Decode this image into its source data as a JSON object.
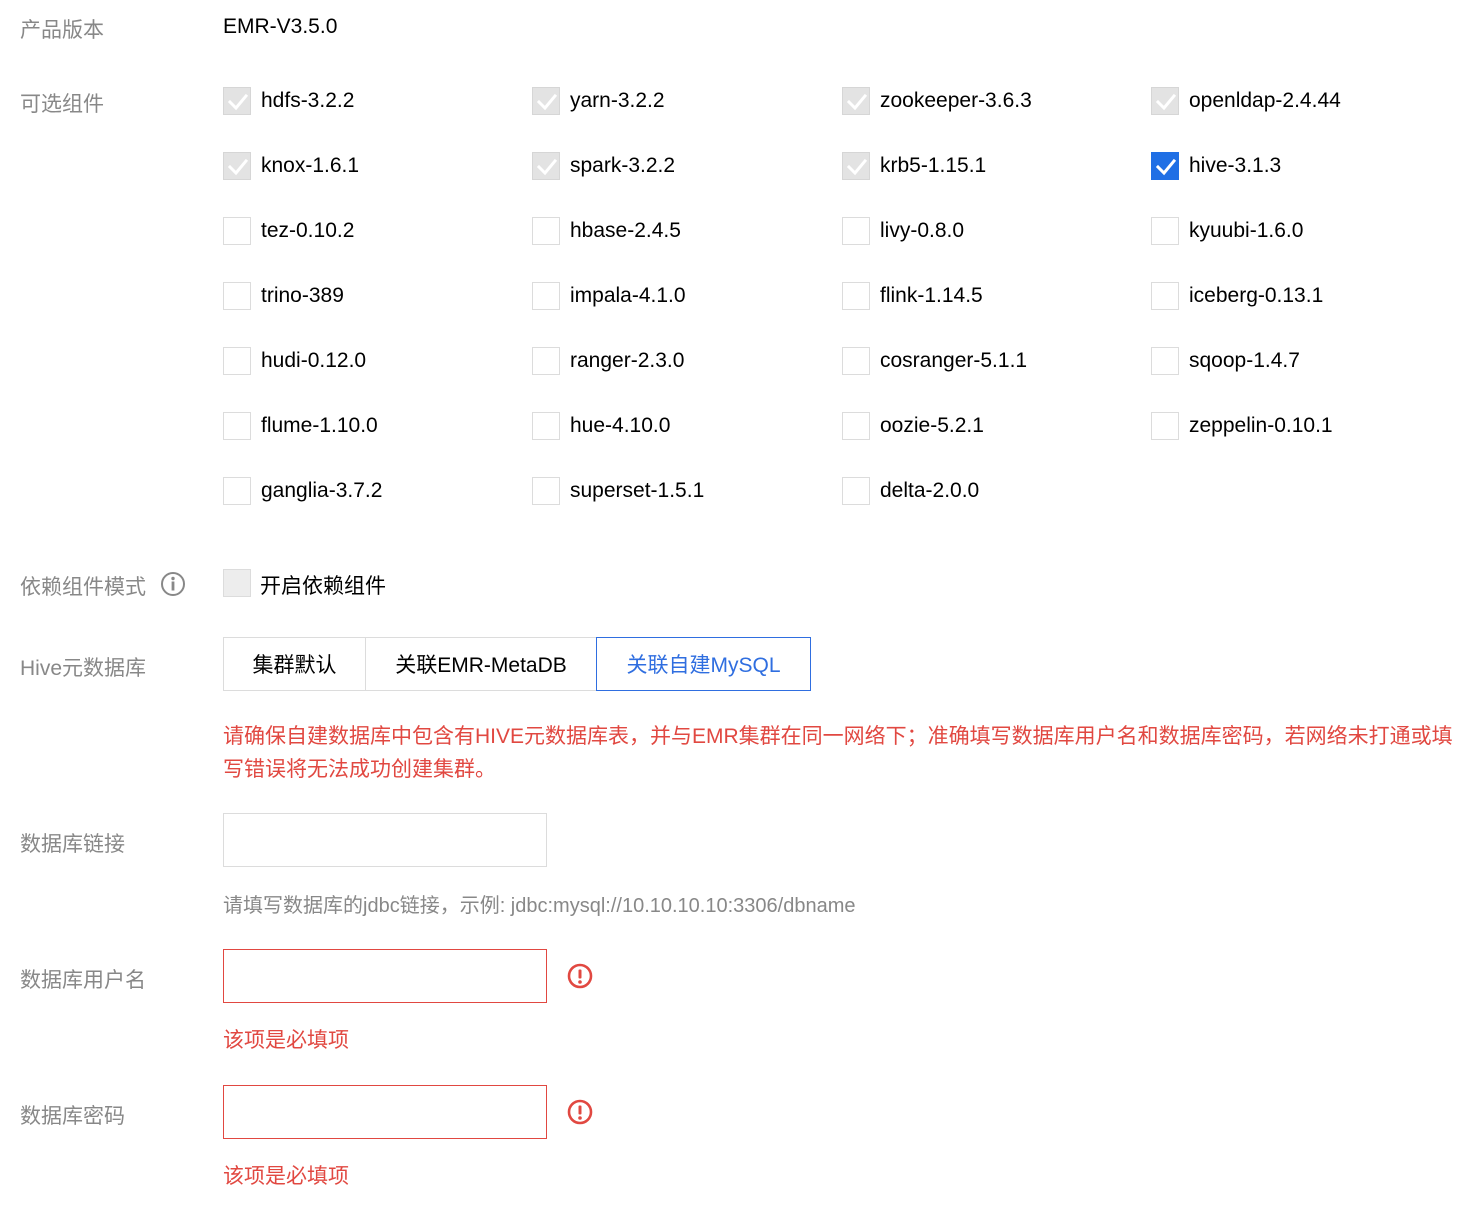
{
  "product_version": {
    "label": "产品版本",
    "value": "EMR-V3.5.0"
  },
  "components": {
    "label": "可选组件",
    "rows": [
      [
        {
          "name": "hdfs-3.2.2",
          "state": "disabled"
        },
        {
          "name": "yarn-3.2.2",
          "state": "disabled"
        },
        {
          "name": "zookeeper-3.6.3",
          "state": "disabled"
        },
        {
          "name": "openldap-2.4.44",
          "state": "disabled"
        }
      ],
      [
        {
          "name": "knox-1.6.1",
          "state": "disabled"
        },
        {
          "name": "spark-3.2.2",
          "state": "disabled"
        },
        {
          "name": "krb5-1.15.1",
          "state": "disabled"
        },
        {
          "name": "hive-3.1.3",
          "state": "checked"
        }
      ],
      [
        {
          "name": "tez-0.10.2",
          "state": "unchecked"
        },
        {
          "name": "hbase-2.4.5",
          "state": "unchecked"
        },
        {
          "name": "livy-0.8.0",
          "state": "unchecked"
        },
        {
          "name": "kyuubi-1.6.0",
          "state": "unchecked"
        }
      ],
      [
        {
          "name": "trino-389",
          "state": "unchecked"
        },
        {
          "name": "impala-4.1.0",
          "state": "unchecked"
        },
        {
          "name": "flink-1.14.5",
          "state": "unchecked"
        },
        {
          "name": "iceberg-0.13.1",
          "state": "unchecked"
        }
      ],
      [
        {
          "name": "hudi-0.12.0",
          "state": "unchecked"
        },
        {
          "name": "ranger-2.3.0",
          "state": "unchecked"
        },
        {
          "name": "cosranger-5.1.1",
          "state": "unchecked"
        },
        {
          "name": "sqoop-1.4.7",
          "state": "unchecked"
        }
      ],
      [
        {
          "name": "flume-1.10.0",
          "state": "unchecked"
        },
        {
          "name": "hue-4.10.0",
          "state": "unchecked"
        },
        {
          "name": "oozie-5.2.1",
          "state": "unchecked"
        },
        {
          "name": "zeppelin-0.10.1",
          "state": "unchecked"
        }
      ],
      [
        {
          "name": "ganglia-3.7.2",
          "state": "unchecked"
        },
        {
          "name": "superset-1.5.1",
          "state": "unchecked"
        },
        {
          "name": "delta-2.0.0",
          "state": "unchecked"
        }
      ]
    ]
  },
  "dependency_mode": {
    "label": "依赖组件模式",
    "icon": "info-icon",
    "checkbox_label": "开启依赖组件"
  },
  "hive_metastore": {
    "label": "Hive元数据库",
    "tabs": [
      {
        "label": "集群默认",
        "active": false
      },
      {
        "label": "关联EMR-MetaDB",
        "active": false
      },
      {
        "label": "关联自建MySQL",
        "active": true
      }
    ],
    "warning": "请确保自建数据库中包含有HIVE元数据库表，并与EMR集群在同一网络下；准确填写数据库用户名和数据库密码，若网络未打通或填写错误将无法成功创建集群。"
  },
  "db_url": {
    "label": "数据库链接",
    "value": "",
    "hint": "请填写数据库的jdbc链接，示例: jdbc:mysql://10.10.10.10:3306/dbname"
  },
  "db_user": {
    "label": "数据库用户名",
    "value": "",
    "error": "该项是必填项",
    "icon": "error-icon"
  },
  "db_password": {
    "label": "数据库密码",
    "value": "",
    "error": "该项是必填项",
    "icon": "error-icon"
  },
  "colors": {
    "primary": "#2f6ee0",
    "checked": "#1f6fe5",
    "error": "#e14841",
    "label": "#888888"
  }
}
